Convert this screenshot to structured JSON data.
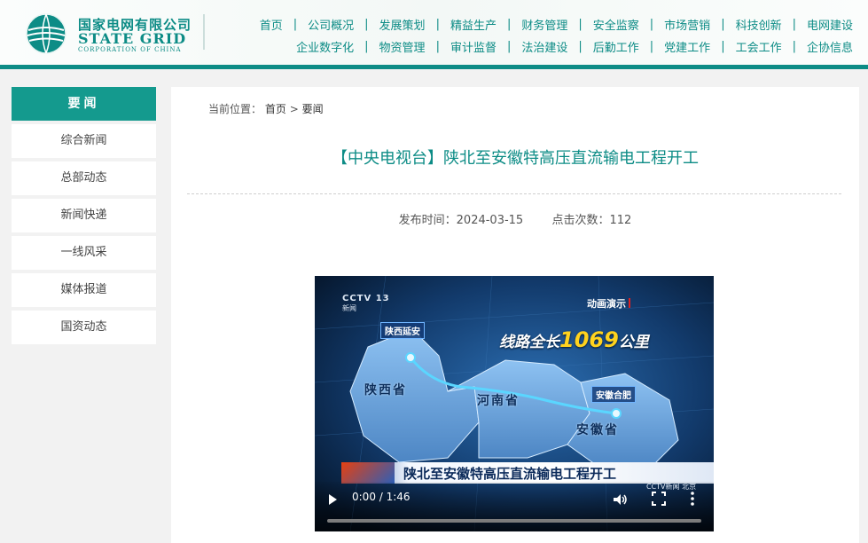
{
  "header": {
    "logo_cn": "国家电网有限公司",
    "logo_en": "STATE GRID",
    "logo_en_sub": "CORPORATION OF CHINA",
    "nav_row1": [
      "首页",
      "公司概况",
      "发展策划",
      "精益生产",
      "财务管理",
      "安全监察",
      "市场营销",
      "科技创新",
      "电网建设"
    ],
    "nav_row2": [
      "企业数字化",
      "物资管理",
      "审计监督",
      "法治建设",
      "后勤工作",
      "党建工作",
      "工会工作",
      "企协信息"
    ],
    "separator": "|"
  },
  "sidebar": {
    "heading": "要闻",
    "items": [
      "综合新闻",
      "总部动态",
      "新闻快递",
      "一线风采",
      "媒体报道",
      "国资动态"
    ]
  },
  "main": {
    "breadcrumb_label": "当前位置：",
    "breadcrumb_home": "首页",
    "breadcrumb_sep": ">",
    "breadcrumb_current": "要闻",
    "title": "【中央电视台】陕北至安徽特高压直流输电工程开工",
    "publish_label": "发布时间：",
    "publish_date": "2024-03-15",
    "clicks_label": "点击次数：",
    "clicks": "112"
  },
  "video": {
    "channel": "CCTV 13",
    "channel_sub": "新闻",
    "anim_label": "动画演示",
    "route_prefix": "线路全长",
    "route_km": "1069",
    "route_suffix": "公里",
    "start_place": "陕西延安",
    "end_place": "安徽合肥",
    "province_1": "陕西省",
    "province_2": "河南省",
    "province_3": "安徽省",
    "caption": "陕北至安徽特高压直流输电工程开工",
    "corner_text": "CCTV新闻 北京",
    "time_display": "0:00 / 1:46",
    "progress_fraction": 0.0
  },
  "colors": {
    "brand": "#0d8c86",
    "sidebar_active": "#149a8e",
    "route_highlight": "#ffd21e"
  }
}
